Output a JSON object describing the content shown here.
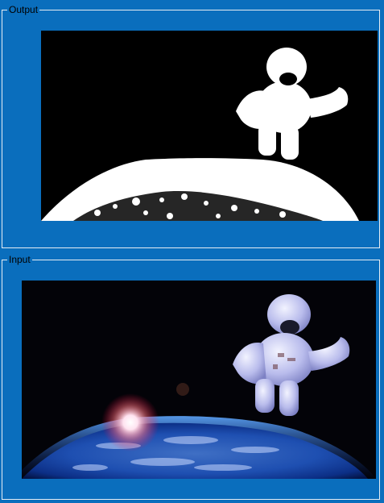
{
  "output_panel": {
    "label": "Output"
  },
  "input_panel": {
    "label": "Input"
  },
  "colors": {
    "background": "#0a6ebd",
    "border": "#e6edf4",
    "image_background": "#000000"
  }
}
